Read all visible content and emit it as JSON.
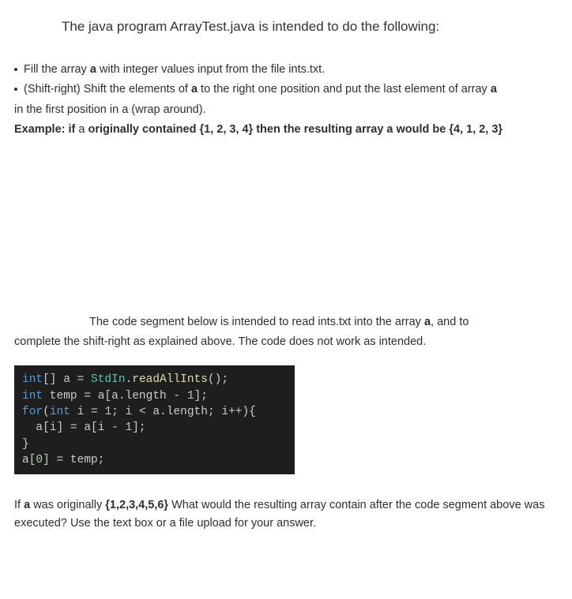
{
  "title": "The java program ArrayTest.java is intended to do the following:",
  "bullet1_pre": "Fill the array ",
  "bullet1_bold": "a",
  "bullet1_post": " with integer values input from the file ints.txt.",
  "bullet2_pre": "(Shift-right) Shift the elements of ",
  "bullet2_bold": "a",
  "bullet2_mid": " to the right one position and put the last element of array ",
  "bullet2_bold2": "a",
  "wrap_line": "in the first position in a (wrap around).",
  "example_pre": "Example: if ",
  "example_norm1": "a",
  "example_mid": " originally contained {1, 2, 3, 4} then the resulting array a would be {4, 1, 2, 3}",
  "intro2_line1_pre": "The code segment below is intended to read ints.txt into the array ",
  "intro2_line1_bold": "a",
  "intro2_line1_post": ", and to",
  "intro2_line2": "complete the shift-right as explained above. The code does not work as intended.",
  "code": {
    "l1": {
      "t1": "int",
      "t2": "[] a = ",
      "t3": "StdIn",
      "t4": ".",
      "t5": "readAllInts",
      "t6": "();"
    },
    "l2": {
      "t1": "int",
      "t2": " temp = a[a.length - ",
      "t3": "1",
      "t4": "];"
    },
    "l3": {
      "t1": "for",
      "t2": "(",
      "t3": "int",
      "t4": " i = ",
      "t5": "1",
      "t6": "; i < a.length; i++){"
    },
    "l4": {
      "t1": "  a[i] = a[i - ",
      "t2": "1",
      "t3": "];"
    },
    "l5": {
      "t1": "}"
    },
    "l6": {
      "t1": "a[",
      "t2": "0",
      "t3": "] = temp;"
    }
  },
  "question_pre": "If ",
  "question_bold1": "a",
  "question_mid1": " was originally ",
  "question_bold2": "{1,2,3,4,5,6}",
  "question_post": " What would the resulting array contain after the code segment above was executed? Use the text box or a file upload for your answer."
}
